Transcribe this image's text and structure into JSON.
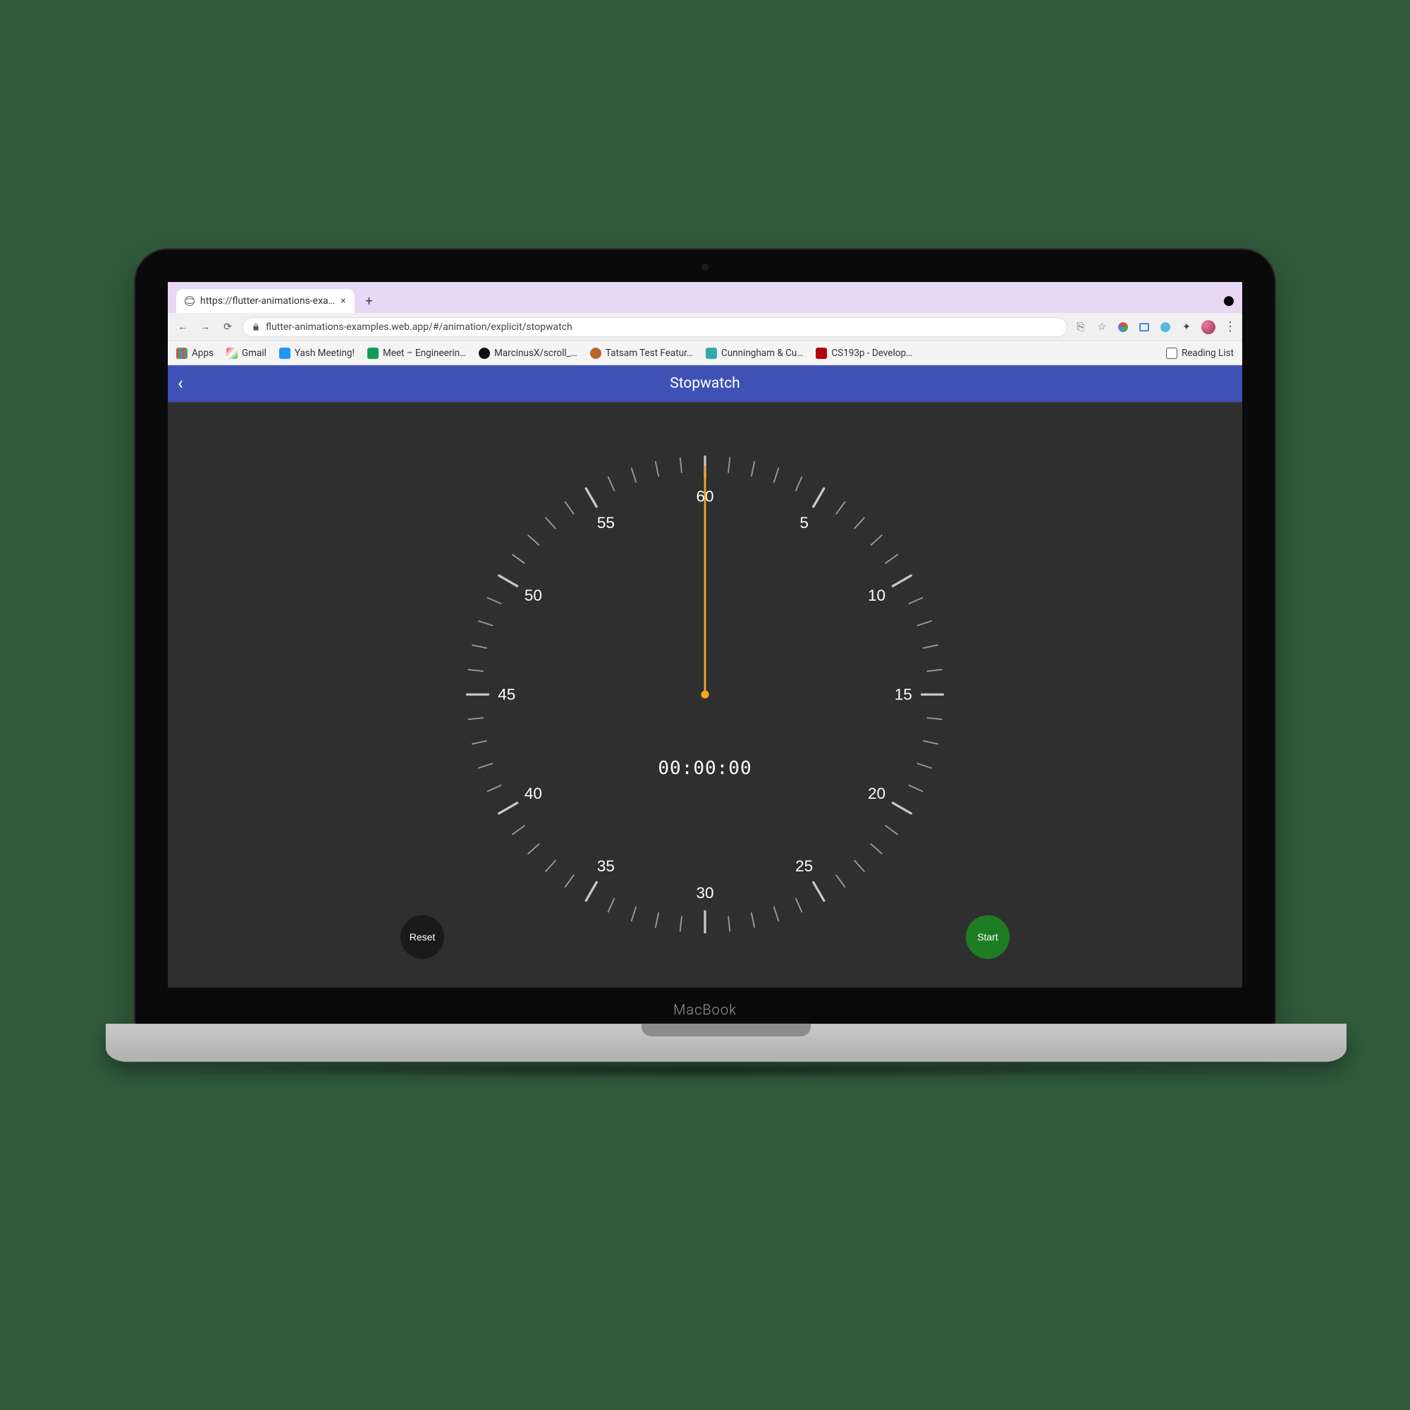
{
  "device": {
    "label": "MacBook"
  },
  "chrome": {
    "tab_title": "https://flutter-animations-exa…",
    "url": "flutter-animations-examples.web.app/#/animation/explicit/stopwatch",
    "bookmarks": {
      "apps": "Apps",
      "gmail": "Gmail",
      "yash": "Yash Meeting!",
      "meet": "Meet – Engineerin…",
      "marcinus": "MarcinusX/scroll_…",
      "tatsam": "Tatsam Test Featur…",
      "cunningham": "Cunningham & Cu…",
      "cs193p": "CS193p - Develop…",
      "reading_list": "Reading List"
    }
  },
  "app": {
    "title": "Stopwatch",
    "elapsed": "00:00:00",
    "reset_label": "Reset",
    "start_label": "Start",
    "ticks": [
      5,
      10,
      15,
      20,
      25,
      30,
      35,
      40,
      45,
      50,
      55,
      60
    ],
    "hand_seconds": 0
  }
}
